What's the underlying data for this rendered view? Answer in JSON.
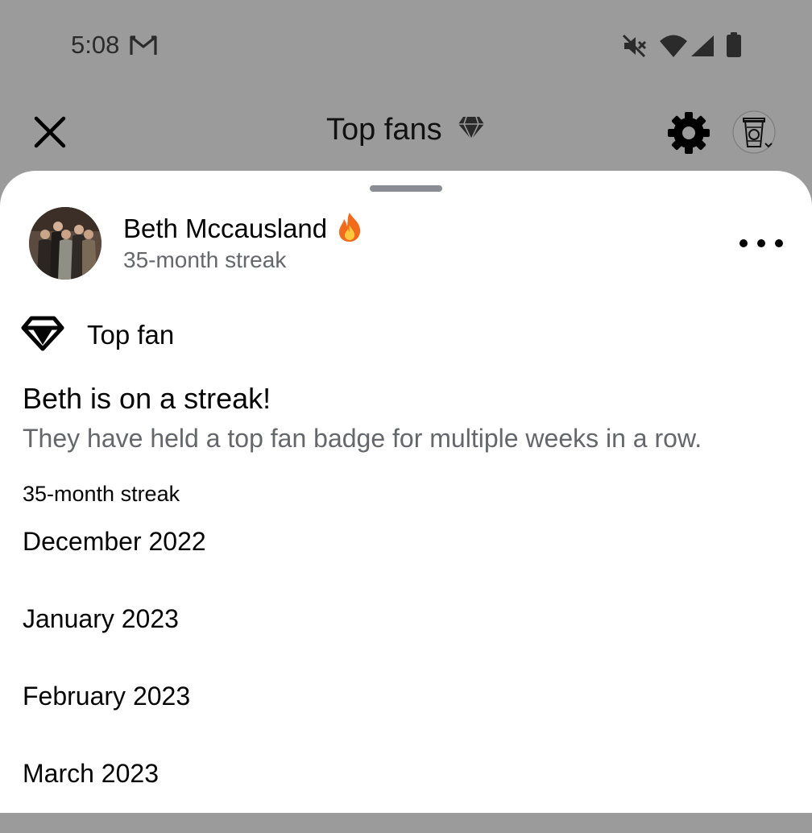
{
  "status_bar": {
    "time": "5:08",
    "icons": [
      "gmail-icon",
      "mute-icon",
      "wifi-icon",
      "signal-icon",
      "battery-icon"
    ]
  },
  "header": {
    "title": "Top fans",
    "close_icon": "close-icon",
    "title_icon": "diamond-icon",
    "settings_icon": "gear-icon",
    "profile_icon": "profile-icon"
  },
  "sheet": {
    "user": {
      "name": "Beth Mccausland",
      "streak": "35-month streak",
      "name_icon": "fire-icon"
    },
    "badge": {
      "label": "Top fan",
      "icon": "diamond-icon"
    },
    "heading": "Beth is on a streak!",
    "description": "They have held a top fan badge for multiple weeks in a row.",
    "streak_label": "35-month streak",
    "months": [
      "December 2022",
      "January 2023",
      "February 2023",
      "March 2023"
    ]
  },
  "colors": {
    "overlay": "#9b9b9b",
    "secondary_text": "#65676b",
    "primary_text": "#050505",
    "sheet_bg": "#ffffff",
    "fire": "#f7931e"
  }
}
